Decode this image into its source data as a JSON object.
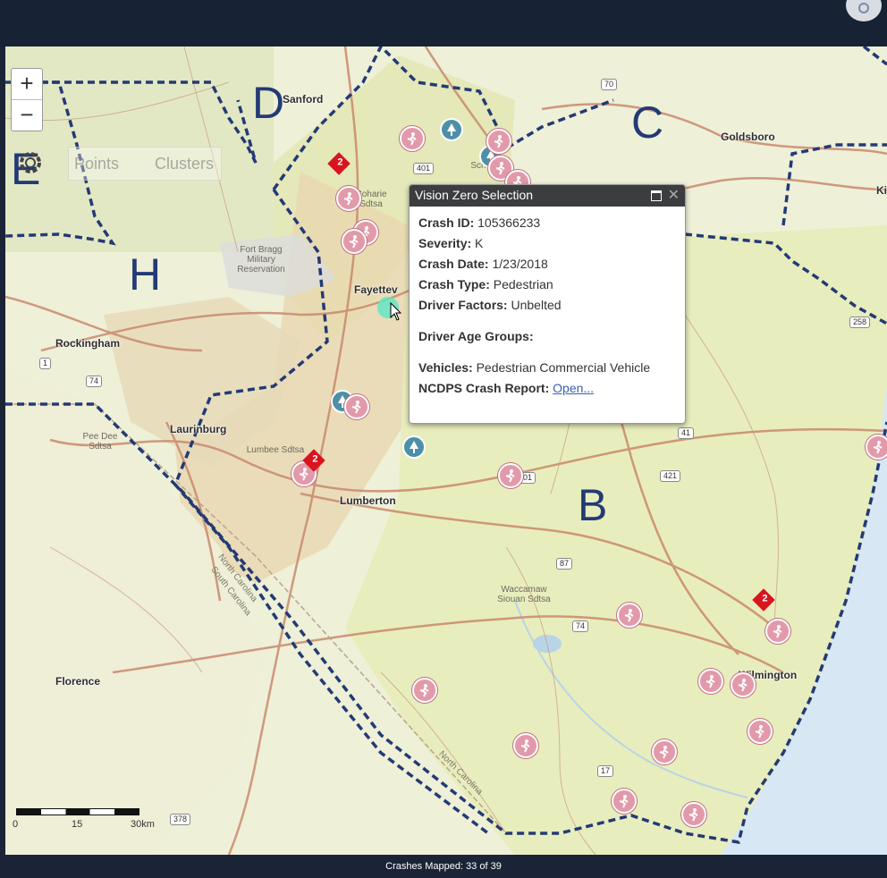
{
  "map": {
    "zoom_in_label": "+",
    "zoom_out_label": "−",
    "toggle": {
      "points_label": "Points",
      "clusters_label": "Clusters"
    },
    "regions": [
      "D",
      "C",
      "H",
      "B",
      "E"
    ],
    "cities": [
      "Sanford",
      "Goldsboro",
      "Ki",
      "Fayettev",
      "Rockingham",
      "Laurinburg",
      "Lumberton",
      "Florence",
      "Wilmington"
    ],
    "features": [
      "Fort Bragg Military Reservation",
      "Coharie Sdtsa",
      "Lumbee Sdtsa",
      "Pee Dee Sdtsa",
      "Waccamaw Siouan Sdtsa",
      "Sch"
    ],
    "state_labels": [
      "North Carolina",
      "South Carolina",
      "North Carolina"
    ],
    "route_shields": [
      "70",
      "401",
      "1",
      "74",
      "41",
      "401",
      "421",
      "87",
      "74",
      "17",
      "378",
      "258"
    ],
    "cluster_counts": [
      "2",
      "2",
      "2"
    ],
    "scale": {
      "labels": [
        "0",
        "15",
        "30km"
      ]
    }
  },
  "popup": {
    "title": "Vision Zero Selection",
    "crash_id_label": "Crash ID:",
    "crash_id": "105366233",
    "severity_label": "Severity:",
    "severity": "K",
    "crash_date_label": "Crash Date:",
    "crash_date": "1/23/2018",
    "crash_type_label": "Crash Type:",
    "crash_type": "Pedestrian",
    "driver_factors_label": "Driver Factors:",
    "driver_factors": "Unbelted",
    "driver_age_label": "Driver Age Groups:",
    "vehicles_label": "Vehicles:",
    "vehicles": "Pedestrian Commercial Vehicle",
    "report_label": "NCDPS Crash Report:",
    "report_link": "Open..."
  },
  "footer": {
    "status": "Crashes Mapped: 33 of 39"
  },
  "colors": {
    "region_border": "#233a76",
    "marker": "#e29aaa",
    "cluster": "#d9141f",
    "selected": "#63e6c2"
  }
}
